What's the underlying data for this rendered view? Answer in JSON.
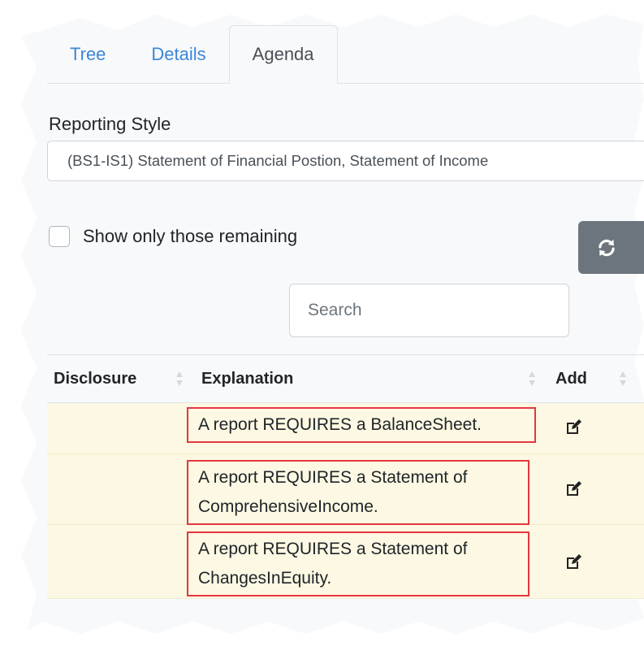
{
  "tabs": [
    {
      "label": "Tree",
      "active": false
    },
    {
      "label": "Details",
      "active": false
    },
    {
      "label": "Agenda",
      "active": true
    }
  ],
  "reporting_style": {
    "label": "Reporting Style",
    "selected": "(BS1-IS1) Statement of Financial Postion, Statement of Income"
  },
  "filter": {
    "checkbox_label": "Show only those remaining",
    "checked": false
  },
  "refresh_button": {
    "icon": "refresh-icon"
  },
  "search": {
    "placeholder": "Search",
    "value": ""
  },
  "table": {
    "columns": [
      "Disclosure",
      "Explanation",
      "Add"
    ],
    "rows": [
      {
        "disclosure": "",
        "explanation": "A report REQUIRES a BalanceSheet.",
        "add_icon": "edit-icon"
      },
      {
        "disclosure": "",
        "explanation": "A report REQUIRES a Statement of ComprehensiveIncome.",
        "add_icon": "edit-icon"
      },
      {
        "disclosure": "",
        "explanation": "A report REQUIRES a Statement of ChangesInEquity.",
        "add_icon": "edit-icon"
      }
    ]
  },
  "colors": {
    "tab_link": "#3b86d8",
    "row_highlight": "#fcf8e3",
    "annotation_border": "#e3373f",
    "button_secondary": "#6c757d"
  }
}
